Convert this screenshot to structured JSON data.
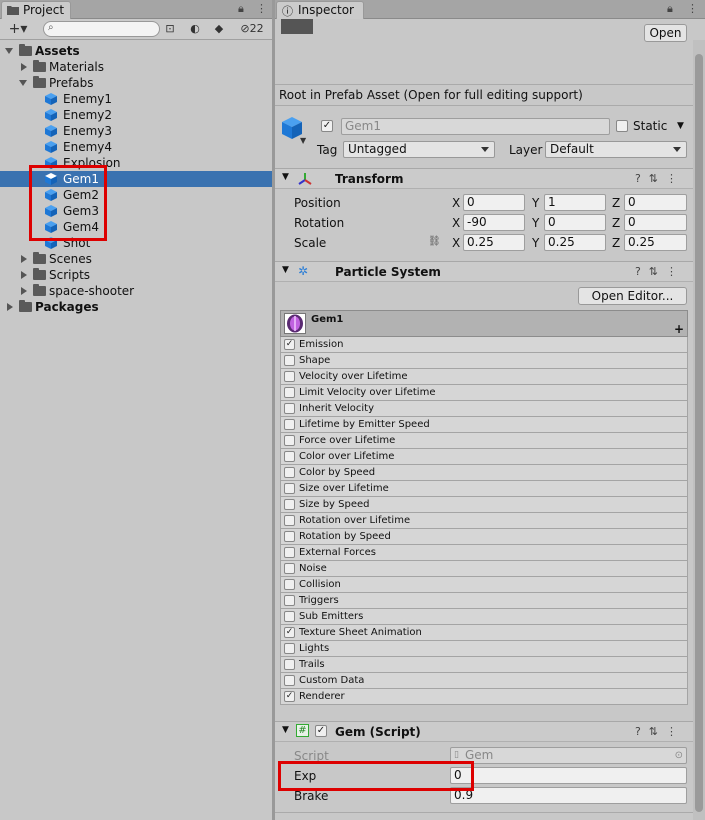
{
  "project": {
    "tab": "Project",
    "add_label": "+▾",
    "search_placeholder": "",
    "hidden_count": "22",
    "tree": [
      {
        "label": "Assets",
        "bold": true,
        "type": "folder",
        "depth": 0,
        "expanded": true
      },
      {
        "label": "Materials",
        "type": "folder",
        "depth": 1,
        "expanded": false
      },
      {
        "label": "Prefabs",
        "type": "folder",
        "depth": 1,
        "expanded": true
      },
      {
        "label": "Enemy1",
        "type": "prefab",
        "depth": 2
      },
      {
        "label": "Enemy2",
        "type": "prefab",
        "depth": 2
      },
      {
        "label": "Enemy3",
        "type": "prefab",
        "depth": 2
      },
      {
        "label": "Enemy4",
        "type": "prefab",
        "depth": 2
      },
      {
        "label": "Explosion",
        "type": "prefab",
        "depth": 2
      },
      {
        "label": "Gem1",
        "type": "prefab",
        "depth": 2,
        "selected": true
      },
      {
        "label": "Gem2",
        "type": "prefab",
        "depth": 2
      },
      {
        "label": "Gem3",
        "type": "prefab",
        "depth": 2
      },
      {
        "label": "Gem4",
        "type": "prefab",
        "depth": 2
      },
      {
        "label": "Shot",
        "type": "prefab",
        "depth": 2
      },
      {
        "label": "Scenes",
        "type": "folder",
        "depth": 1,
        "expanded": false
      },
      {
        "label": "Scripts",
        "type": "folder",
        "depth": 1,
        "expanded": false
      },
      {
        "label": "space-shooter",
        "type": "folder",
        "depth": 1,
        "expanded": false
      },
      {
        "label": "Packages",
        "bold": true,
        "type": "folder",
        "depth": 0,
        "expanded": false
      }
    ]
  },
  "inspector": {
    "tab": "Inspector",
    "open_button": "Open",
    "prefab_note": "Root in Prefab Asset (Open for full editing support)",
    "object_name": "Gem1",
    "static_label": "Static",
    "tag_label": "Tag",
    "tag_value": "Untagged",
    "layer_label": "Layer",
    "layer_value": "Default",
    "transform": {
      "title": "Transform",
      "position_label": "Position",
      "rotation_label": "Rotation",
      "scale_label": "Scale",
      "position": [
        "0",
        "1",
        "0"
      ],
      "rotation": [
        "-90",
        "0",
        "0"
      ],
      "scale": [
        "0.25",
        "0.25",
        "0.25"
      ],
      "axes": [
        "X",
        "Y",
        "Z"
      ]
    },
    "particle": {
      "title": "Particle System",
      "open_editor": "Open Editor...",
      "system_name": "Gem1",
      "plus": "+",
      "modules": [
        {
          "label": "Emission",
          "checked": true
        },
        {
          "label": "Shape",
          "checked": false
        },
        {
          "label": "Velocity over Lifetime",
          "checked": false
        },
        {
          "label": "Limit Velocity over Lifetime",
          "checked": false
        },
        {
          "label": "Inherit Velocity",
          "checked": false
        },
        {
          "label": "Lifetime by Emitter Speed",
          "checked": false
        },
        {
          "label": "Force over Lifetime",
          "checked": false
        },
        {
          "label": "Color over Lifetime",
          "checked": false
        },
        {
          "label": "Color by Speed",
          "checked": false
        },
        {
          "label": "Size over Lifetime",
          "checked": false
        },
        {
          "label": "Size by Speed",
          "checked": false
        },
        {
          "label": "Rotation over Lifetime",
          "checked": false
        },
        {
          "label": "Rotation by Speed",
          "checked": false
        },
        {
          "label": "External Forces",
          "checked": false
        },
        {
          "label": "Noise",
          "checked": false
        },
        {
          "label": "Collision",
          "checked": false
        },
        {
          "label": "Triggers",
          "checked": false
        },
        {
          "label": "Sub Emitters",
          "checked": false
        },
        {
          "label": "Texture Sheet Animation",
          "checked": true
        },
        {
          "label": "Lights",
          "checked": false
        },
        {
          "label": "Trails",
          "checked": false
        },
        {
          "label": "Custom Data",
          "checked": false
        },
        {
          "label": "Renderer",
          "checked": true
        }
      ]
    },
    "gem_script": {
      "title": "Gem (Script)",
      "script_label": "Script",
      "script_value": "Gem",
      "exp_label": "Exp",
      "exp_value": "0",
      "brake_label": "Brake",
      "brake_value": "0.9"
    }
  },
  "colors": {
    "selection": "#3a72b0",
    "highlight": "#dd0000",
    "prefab_icon": "#1e78d6"
  }
}
